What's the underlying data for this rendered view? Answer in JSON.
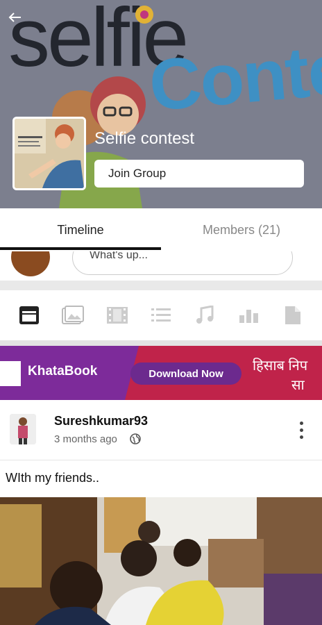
{
  "header": {
    "back_icon": "back-arrow-icon",
    "cover_word": "selfie",
    "cover_word2": "Conte",
    "group_name": "Selfie contest",
    "join_button": "Join Group"
  },
  "tabs": [
    {
      "label": "Timeline",
      "active": true
    },
    {
      "label": "Members (21)",
      "active": false
    }
  ],
  "status_bar": {
    "placeholder": "What's up..."
  },
  "media_types": [
    {
      "icon": "text-post-icon",
      "active": true
    },
    {
      "icon": "photo-icon",
      "active": false
    },
    {
      "icon": "video-icon",
      "active": false
    },
    {
      "icon": "list-icon",
      "active": false
    },
    {
      "icon": "music-icon",
      "active": false
    },
    {
      "icon": "poll-icon",
      "active": false
    },
    {
      "icon": "file-icon",
      "active": false
    }
  ],
  "ad": {
    "brand": "KhataBook",
    "cta": "Download Now",
    "hindi_line1": "हिसाब निप",
    "hindi_line2": "सा"
  },
  "post": {
    "username": "Sureshkumar93",
    "time": "3 months ago",
    "text": "WIth my friends.."
  },
  "colors": {
    "cover_bg": "#7c7f8e",
    "ad_purple": "#7d2b9a",
    "ad_red": "#c0234a",
    "accent_blue": "#3e90c4"
  }
}
